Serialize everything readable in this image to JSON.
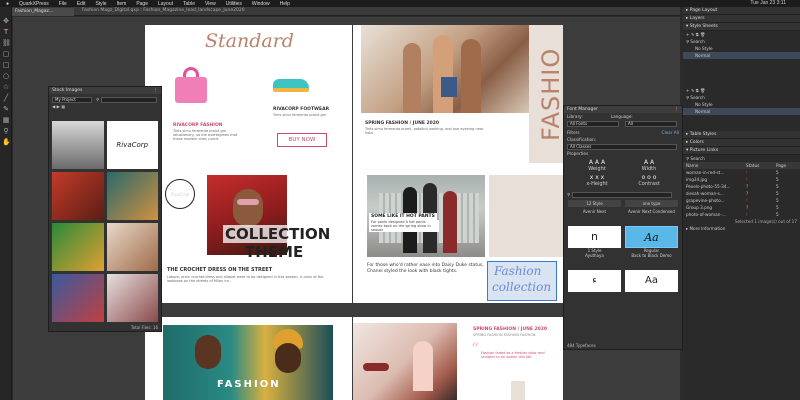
{
  "menubar": {
    "items": [
      "QuarkXPress",
      "File",
      "Edit",
      "Style",
      "Item",
      "Page",
      "Layout",
      "Table",
      "View",
      "Utilities",
      "Window",
      "Help"
    ],
    "clock": "Tue Jan 23  3:11"
  },
  "window": {
    "title": "Fashion Magz_Digital.qxp : Fashion_Magazine_lead_landscape_June2020",
    "tab": "Fashion_Magaz..."
  },
  "stock_panel": {
    "title": "Stock Images",
    "project": "My Project",
    "total": "Total Files: 16"
  },
  "layout": {
    "p1_heading": "Standard",
    "p1_caption1_title": "RIVACORP FASHION",
    "p1_caption1_text": "Trnts simu fermenta proivt grn lotustionary, so the evertegmes that these modern ones cured.",
    "p1_caption2_title": "RIVACORP FOOTWEAR",
    "p1_caption2_text": "Trnts simu fermenta proivt grn",
    "p1_buy": "BUY NOW",
    "p2_side": "FASHIO",
    "p2_caption_title": "SPRING FASHION / JUNE 2020",
    "p2_caption_text": "Trnts simu fermenta orami, potalbul working, and one evening near hold.",
    "p3_heading1": "COLLECTION",
    "p3_heading2": "THEME",
    "p3_sub": "THE CROCHET DRESS ON THE STREET",
    "p3_text": "Labore, proin crochet dress and aliquet were to be designed in this season. A color of the lookbook on the streets of Milan inc.",
    "p4_title": "SOME LIKE IT HOT PANTS",
    "p4_text": "For pants designed it hot pants comes back on the spring show in season",
    "p4_quote": "For those who'd rather ease into Daisy Duke status, Chanel styled the look with black tights.",
    "p4_script1": "Fashion",
    "p4_script2": "collection",
    "p5_label": "FASHION",
    "p6_caption_title": "SPRING FASHION / JUNE 2020",
    "p6_caption_sub": "SPRING FASHION FASHION FASHION",
    "p6_quote": "Fashion faded as a fresher color and sculptor to an option this fall"
  },
  "font_manager": {
    "title": "Font Manager",
    "library_label": "Library:",
    "library_value": "All Fonts",
    "language_label": "Language:",
    "language_value": "All",
    "filters": "Filters",
    "clear_all": "Clear All",
    "classification_label": "Classification:",
    "classification_value": "All Classes",
    "properties": "Properties",
    "props": [
      "Weight",
      "Width",
      "x-Height",
      "Contrast"
    ],
    "fonts": [
      {
        "sample": "12 Style",
        "name": "Avenir Next"
      },
      {
        "sample": "one type",
        "name": "Avenir Next Condensed"
      },
      {
        "sample": "n",
        "name": "1 Style",
        "sub": "Ayuthaya"
      },
      {
        "sample": "Aa",
        "name": "Regular",
        "sub": "Back to Black Demo"
      },
      {
        "sample": "ء",
        "name": ""
      },
      {
        "sample": "Aa",
        "name": ""
      }
    ],
    "footer": "484 Typefaces"
  },
  "right_panels": {
    "page_layout": "Page Layout",
    "layers": "Layers",
    "style_sheets": "Style Sheets",
    "search1": "Search",
    "styles1": [
      "No Style",
      "Normal"
    ],
    "search2": "Search",
    "styles2": [
      "No Style",
      "Normal"
    ],
    "table_styles": "Table Styles",
    "colors": "Colors",
    "picture_links": "Picture Links",
    "search3": "Search",
    "link_cols": [
      "Name",
      "Status",
      "Page"
    ],
    "links": [
      {
        "name": "woman-in-red-st...",
        "status": "!",
        "page": "5"
      },
      {
        "name": "img34.jpg",
        "status": "!",
        "page": "5"
      },
      {
        "name": "Pexels-photo-55-34...",
        "status": "?",
        "page": "5"
      },
      {
        "name": "ziesah-woman-s...",
        "status": "?",
        "page": "5"
      },
      {
        "name": "grapevine-photo...",
        "status": "!",
        "page": "5"
      },
      {
        "name": "Group 3.png",
        "status": "?",
        "page": "5"
      },
      {
        "name": "photo-of-woman-...",
        "status": "!",
        "page": "5"
      }
    ],
    "selected": "Selected 1 image(s) out of 17",
    "more": "More Information"
  },
  "colors": {
    "accent": "#c94c6a",
    "fashion": "#b9826b",
    "panel": "#323232",
    "script": "#6b8cd0"
  }
}
